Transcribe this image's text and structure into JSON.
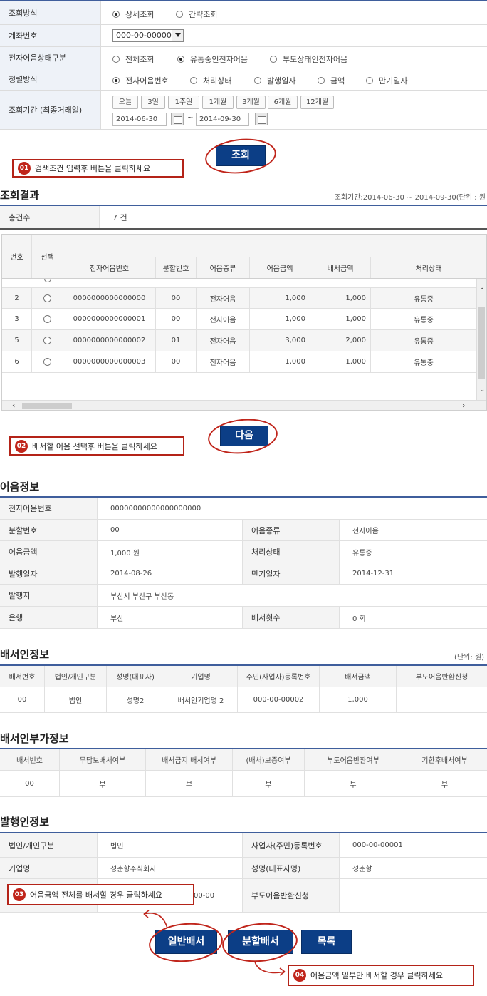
{
  "search_form": {
    "rows": {
      "inquiry_method": {
        "label": "조회방식",
        "options": [
          {
            "label": "상세조회",
            "selected": true
          },
          {
            "label": "간략조회",
            "selected": false
          }
        ]
      },
      "account_no": {
        "label": "계좌번호",
        "value": "000-00-00000"
      },
      "note_status": {
        "label": "전자어음상태구분",
        "options": [
          {
            "label": "전체조회",
            "selected": false
          },
          {
            "label": "유통중인전자어음",
            "selected": true
          },
          {
            "label": "부도상태인전자어음",
            "selected": false
          }
        ]
      },
      "sort_method": {
        "label": "정렬방식",
        "options": [
          {
            "label": "전자어음번호",
            "selected": true
          },
          {
            "label": "처리상태",
            "selected": false
          },
          {
            "label": "발행일자",
            "selected": false
          },
          {
            "label": "금액",
            "selected": false
          },
          {
            "label": "만기일자",
            "selected": false
          }
        ]
      },
      "period": {
        "label": "조회기간 (최종거래일)",
        "buttons": [
          "오늘",
          "3일",
          "1주일",
          "1개월",
          "3개월",
          "6개월",
          "12개월"
        ],
        "from": "2014-06-30",
        "tilde": "~",
        "to": "2014-09-30"
      }
    },
    "search_button": "조회"
  },
  "notes": {
    "n1": {
      "num": "01",
      "text": "검색조건 입력후  버튼을 클릭하세요"
    },
    "n2": {
      "num": "02",
      "text": "배서할 어음 선택후 버튼을 클릭하세요"
    },
    "n3": {
      "num": "03",
      "text": "어음금액 전체를 배서할 경우 클릭하세요"
    },
    "n4": {
      "num": "04",
      "text": "어음금액 일부만 배서할 경우 클릭하세요"
    }
  },
  "results": {
    "title": "조회결과",
    "period_text": "조회기간:2014-06-30 ~ 2014-09-30(단위 : 원",
    "total_label": "총건수",
    "total_value": "7 건",
    "columns": [
      "번호",
      "선택",
      "전자어음번호",
      "분할번호",
      "어음종류",
      "어음금액",
      "배서금액",
      "처리상태"
    ],
    "rows": [
      {
        "no": "2",
        "note_no": "0000000000000000",
        "split": "00",
        "type": "전자어음",
        "amount": "1,000",
        "endorse": "1,000",
        "status": "유통중"
      },
      {
        "no": "3",
        "note_no": "0000000000000001",
        "split": "00",
        "type": "전자어음",
        "amount": "1,000",
        "endorse": "1,000",
        "status": "유통중"
      },
      {
        "no": "5",
        "note_no": "0000000000000002",
        "split": "01",
        "type": "전자어음",
        "amount": "3,000",
        "endorse": "2,000",
        "status": "유통중"
      },
      {
        "no": "6",
        "note_no": "0000000000000003",
        "split": "00",
        "type": "전자어음",
        "amount": "1,000",
        "endorse": "1,000",
        "status": "유통중"
      }
    ],
    "next_button": "다음"
  },
  "note_info": {
    "title": "어음정보",
    "rows": [
      {
        "l1": "전자어음번호",
        "v1": "00000000000000000000"
      },
      {
        "l1": "분할번호",
        "v1": "00",
        "l2": "어음종류",
        "v2": "전자어음"
      },
      {
        "l1": "어음금액",
        "v1": "1,000 원",
        "l2": "처리상태",
        "v2": "유통중"
      },
      {
        "l1": "발행일자",
        "v1": "2014-08-26",
        "l2": "만기일자",
        "v2": "2014-12-31"
      },
      {
        "l1": "발행지",
        "v1": "부산시 부산구 부산동"
      },
      {
        "l1": "은행",
        "v1": "부산",
        "l2": "배서횟수",
        "v2": "0 회"
      }
    ]
  },
  "endorser_info": {
    "title": "배서인정보",
    "unit": "(단위: 원)",
    "columns": [
      "배서번호",
      "법인/개인구분",
      "성명(대표자)",
      "기업명",
      "주민(사업자)등록번호",
      "배서금액",
      "부도어음반환신청"
    ],
    "row": [
      "00",
      "법인",
      "성명2",
      "배서인기업명 2",
      "000-00-00002",
      "1,000",
      ""
    ]
  },
  "endorser_extra": {
    "title": "배서인부가정보",
    "columns": [
      "배서번호",
      "무담보배서여부",
      "배서금지 배서여부",
      "(배서)보증여부",
      "부도어음반환여부",
      "기한후배서여부"
    ],
    "row": [
      "00",
      "부",
      "부",
      "부",
      "부",
      "부"
    ]
  },
  "issuer_info": {
    "title": "발행인정보",
    "rows": [
      {
        "l1": "법인/개인구분",
        "v1": "법인",
        "l2": "사업자(주민)등록번호",
        "v2": "000-00-00001"
      },
      {
        "l1": "기업명",
        "v1": "성춘향주식회사",
        "l2": "성명(대표자명)",
        "v2": "성춘향"
      },
      {
        "l1": "",
        "v1": "00-00",
        "l2": "부도어음반환신청",
        "v2": ""
      }
    ]
  },
  "bottom_buttons": {
    "general": "일반배서",
    "split": "분할배서",
    "list": "목록"
  }
}
